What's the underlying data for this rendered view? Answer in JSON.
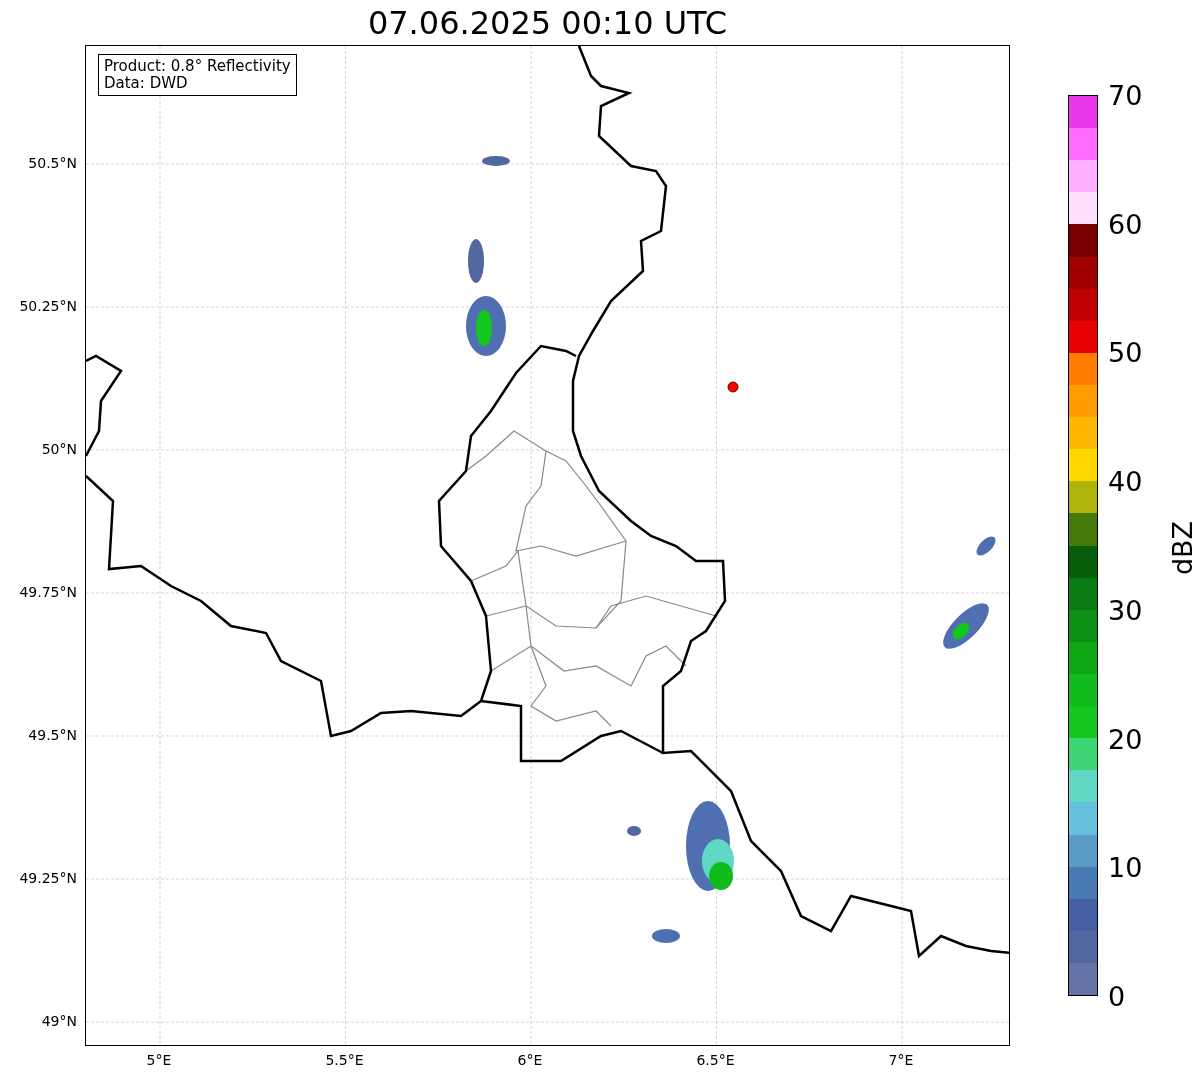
{
  "title": "07.06.2025 00:10 UTC",
  "info_box": {
    "lines": [
      "Product: 0.8° Reflectivity",
      "Data: DWD"
    ]
  },
  "map": {
    "lat_labels": [
      "50.5°N",
      "50.25°N",
      "50°N",
      "49.75°N",
      "49.5°N",
      "49.25°N",
      "49°N"
    ],
    "lon_labels": [
      "5°E",
      "5.5°E",
      "6°E",
      "6.5°E",
      "7°E"
    ]
  },
  "colorbar": {
    "label": "dBZ",
    "ticks": [
      "70",
      "60",
      "50",
      "40",
      "30",
      "20",
      "10",
      "0"
    ],
    "bands": [
      {
        "color": "#e838e8"
      },
      {
        "color": "#ff6cff"
      },
      {
        "color": "#ffb0ff"
      },
      {
        "color": "#ffe0ff"
      },
      {
        "color": "#780000"
      },
      {
        "color": "#a00000"
      },
      {
        "color": "#c00000"
      },
      {
        "color": "#e60000"
      },
      {
        "color": "#ff7c00"
      },
      {
        "color": "#ff9c00"
      },
      {
        "color": "#ffb800"
      },
      {
        "color": "#ffd800"
      },
      {
        "color": "#b0b40a"
      },
      {
        "color": "#467a0a"
      },
      {
        "color": "#065e0c"
      },
      {
        "color": "#0a7a12"
      },
      {
        "color": "#0c9014"
      },
      {
        "color": "#0ea816"
      },
      {
        "color": "#10bc1c"
      },
      {
        "color": "#12c81e"
      },
      {
        "color": "#3cd474"
      },
      {
        "color": "#60d8c4"
      },
      {
        "color": "#66c2dc"
      },
      {
        "color": "#5a9cc6"
      },
      {
        "color": "#4a7ab3"
      },
      {
        "color": "#4560a3"
      },
      {
        "color": "#5266a0"
      },
      {
        "color": "#6474a6"
      }
    ]
  }
}
